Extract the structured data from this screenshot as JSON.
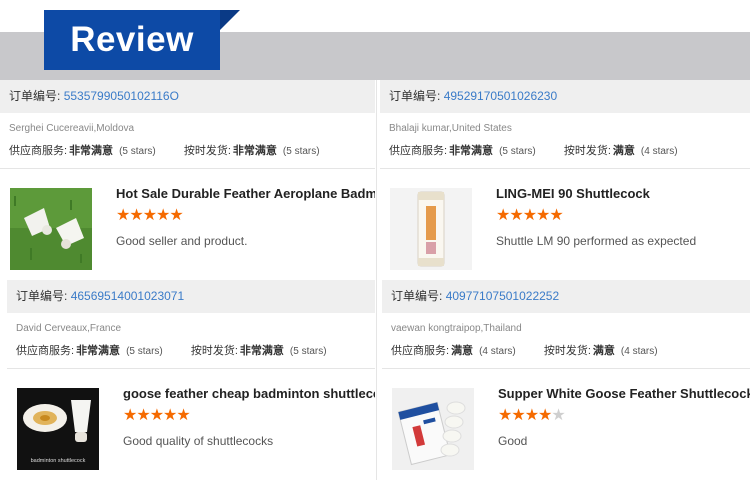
{
  "banner": {
    "label": "Review"
  },
  "labels": {
    "order_label": "订单编号:",
    "supplier_service": "供应商服务:",
    "on_time_shipping": "按时发货:"
  },
  "reviews": [
    {
      "order_no": "5535799050102116O",
      "buyer": "Serghei Cucereavii,Moldova",
      "supplier_rating": "非常满意",
      "supplier_stars": "(5 stars)",
      "shipping_rating": "非常满意",
      "shipping_stars": "(5 stars)",
      "product_title": "Hot Sale Durable Feather Aeroplane Badminton",
      "stars": 5,
      "comment": "Good seller and product."
    },
    {
      "order_no": "49529170501026230",
      "buyer": "Bhalaji kumar,United States",
      "supplier_rating": "非常满意",
      "supplier_stars": "(5 stars)",
      "shipping_rating": "满意",
      "shipping_stars": "(4 stars)",
      "product_title": "LING-MEI 90 Shuttlecock",
      "stars": 5,
      "comment": "Shuttle LM 90 performed as expected"
    },
    {
      "order_no": "46569514001023071",
      "buyer": "David Cerveaux,France",
      "supplier_rating": "非常满意",
      "supplier_stars": "(5 stars)",
      "shipping_rating": "非常满意",
      "shipping_stars": "(5 stars)",
      "product_title": "goose feather cheap badminton shuttlecock wholesale",
      "stars": 5,
      "comment": "Good quality of shuttlecocks"
    },
    {
      "order_no": "40977107501022252",
      "buyer": "vaewan kongtraipop,Thailand",
      "supplier_rating": "满意",
      "supplier_stars": "(4 stars)",
      "shipping_rating": "满意",
      "shipping_stars": "(4 stars)",
      "product_title": "Supper White Goose Feather Shuttlecock",
      "stars": 4,
      "comment": "Good"
    }
  ],
  "thumbnails": [
    {
      "icon": "shuttlecock-on-grass-photo"
    },
    {
      "icon": "shuttlecock-tube-photo"
    },
    {
      "icon": "shuttlecock-closeup-photo",
      "caption": "badminton shuttlecock"
    },
    {
      "icon": "shuttlecock-box-photo"
    }
  ]
}
